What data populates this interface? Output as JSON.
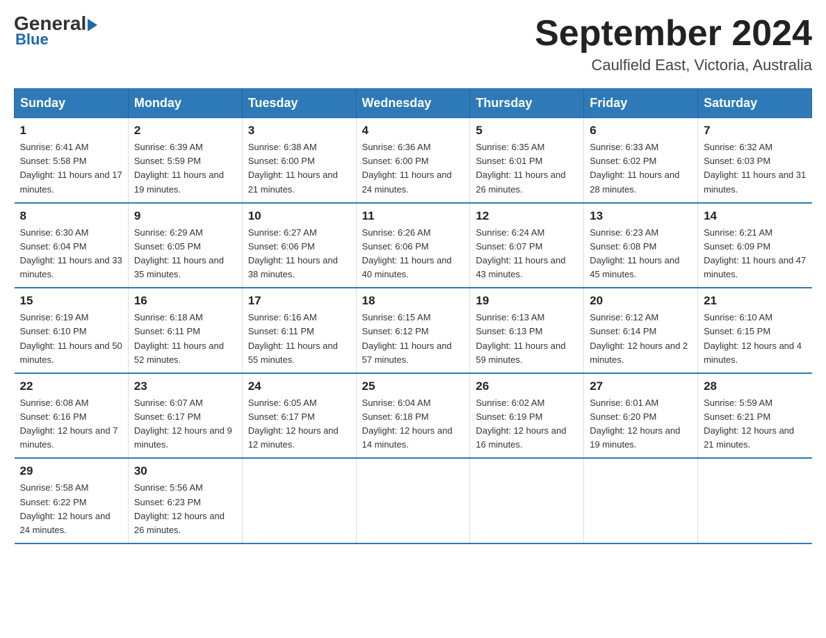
{
  "logo": {
    "line1_black": "General",
    "arrow": "▶",
    "line2": "Blue"
  },
  "title": "September 2024",
  "location": "Caulfield East, Victoria, Australia",
  "days_of_week": [
    "Sunday",
    "Monday",
    "Tuesday",
    "Wednesday",
    "Thursday",
    "Friday",
    "Saturday"
  ],
  "weeks": [
    [
      {
        "day": "1",
        "sunrise": "6:41 AM",
        "sunset": "5:58 PM",
        "daylight": "11 hours and 17 minutes."
      },
      {
        "day": "2",
        "sunrise": "6:39 AM",
        "sunset": "5:59 PM",
        "daylight": "11 hours and 19 minutes."
      },
      {
        "day": "3",
        "sunrise": "6:38 AM",
        "sunset": "6:00 PM",
        "daylight": "11 hours and 21 minutes."
      },
      {
        "day": "4",
        "sunrise": "6:36 AM",
        "sunset": "6:00 PM",
        "daylight": "11 hours and 24 minutes."
      },
      {
        "day": "5",
        "sunrise": "6:35 AM",
        "sunset": "6:01 PM",
        "daylight": "11 hours and 26 minutes."
      },
      {
        "day": "6",
        "sunrise": "6:33 AM",
        "sunset": "6:02 PM",
        "daylight": "11 hours and 28 minutes."
      },
      {
        "day": "7",
        "sunrise": "6:32 AM",
        "sunset": "6:03 PM",
        "daylight": "11 hours and 31 minutes."
      }
    ],
    [
      {
        "day": "8",
        "sunrise": "6:30 AM",
        "sunset": "6:04 PM",
        "daylight": "11 hours and 33 minutes."
      },
      {
        "day": "9",
        "sunrise": "6:29 AM",
        "sunset": "6:05 PM",
        "daylight": "11 hours and 35 minutes."
      },
      {
        "day": "10",
        "sunrise": "6:27 AM",
        "sunset": "6:06 PM",
        "daylight": "11 hours and 38 minutes."
      },
      {
        "day": "11",
        "sunrise": "6:26 AM",
        "sunset": "6:06 PM",
        "daylight": "11 hours and 40 minutes."
      },
      {
        "day": "12",
        "sunrise": "6:24 AM",
        "sunset": "6:07 PM",
        "daylight": "11 hours and 43 minutes."
      },
      {
        "day": "13",
        "sunrise": "6:23 AM",
        "sunset": "6:08 PM",
        "daylight": "11 hours and 45 minutes."
      },
      {
        "day": "14",
        "sunrise": "6:21 AM",
        "sunset": "6:09 PM",
        "daylight": "11 hours and 47 minutes."
      }
    ],
    [
      {
        "day": "15",
        "sunrise": "6:19 AM",
        "sunset": "6:10 PM",
        "daylight": "11 hours and 50 minutes."
      },
      {
        "day": "16",
        "sunrise": "6:18 AM",
        "sunset": "6:11 PM",
        "daylight": "11 hours and 52 minutes."
      },
      {
        "day": "17",
        "sunrise": "6:16 AM",
        "sunset": "6:11 PM",
        "daylight": "11 hours and 55 minutes."
      },
      {
        "day": "18",
        "sunrise": "6:15 AM",
        "sunset": "6:12 PM",
        "daylight": "11 hours and 57 minutes."
      },
      {
        "day": "19",
        "sunrise": "6:13 AM",
        "sunset": "6:13 PM",
        "daylight": "11 hours and 59 minutes."
      },
      {
        "day": "20",
        "sunrise": "6:12 AM",
        "sunset": "6:14 PM",
        "daylight": "12 hours and 2 minutes."
      },
      {
        "day": "21",
        "sunrise": "6:10 AM",
        "sunset": "6:15 PM",
        "daylight": "12 hours and 4 minutes."
      }
    ],
    [
      {
        "day": "22",
        "sunrise": "6:08 AM",
        "sunset": "6:16 PM",
        "daylight": "12 hours and 7 minutes."
      },
      {
        "day": "23",
        "sunrise": "6:07 AM",
        "sunset": "6:17 PM",
        "daylight": "12 hours and 9 minutes."
      },
      {
        "day": "24",
        "sunrise": "6:05 AM",
        "sunset": "6:17 PM",
        "daylight": "12 hours and 12 minutes."
      },
      {
        "day": "25",
        "sunrise": "6:04 AM",
        "sunset": "6:18 PM",
        "daylight": "12 hours and 14 minutes."
      },
      {
        "day": "26",
        "sunrise": "6:02 AM",
        "sunset": "6:19 PM",
        "daylight": "12 hours and 16 minutes."
      },
      {
        "day": "27",
        "sunrise": "6:01 AM",
        "sunset": "6:20 PM",
        "daylight": "12 hours and 19 minutes."
      },
      {
        "day": "28",
        "sunrise": "5:59 AM",
        "sunset": "6:21 PM",
        "daylight": "12 hours and 21 minutes."
      }
    ],
    [
      {
        "day": "29",
        "sunrise": "5:58 AM",
        "sunset": "6:22 PM",
        "daylight": "12 hours and 24 minutes."
      },
      {
        "day": "30",
        "sunrise": "5:56 AM",
        "sunset": "6:23 PM",
        "daylight": "12 hours and 26 minutes."
      },
      null,
      null,
      null,
      null,
      null
    ]
  ]
}
